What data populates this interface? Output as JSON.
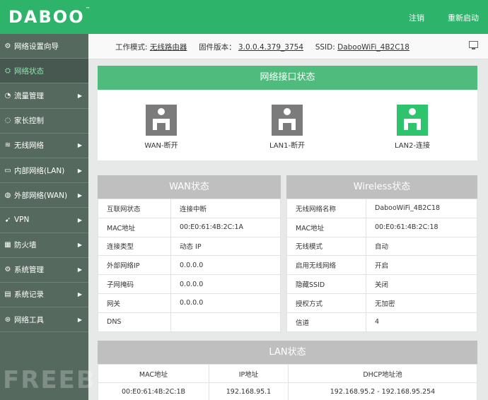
{
  "header": {
    "logo": "DABOO",
    "logo_tm": "™",
    "logout": "注销",
    "reboot": "重新启动"
  },
  "sidebar": {
    "items": [
      {
        "label": "网络设置向导",
        "icon": "gear-icon",
        "has_arrow": false
      },
      {
        "label": "网络状态",
        "icon": "network-status-icon",
        "has_arrow": false,
        "active": true
      },
      {
        "label": "流量管理",
        "icon": "traffic-icon",
        "has_arrow": true
      },
      {
        "label": "家长控制",
        "icon": "bell-icon",
        "has_arrow": false
      },
      {
        "label": "无线网络",
        "icon": "wifi-icon",
        "has_arrow": true
      },
      {
        "label": "内部网络(LAN)",
        "icon": "lan-icon",
        "has_arrow": true
      },
      {
        "label": "外部网络(WAN)",
        "icon": "globe-icon",
        "has_arrow": true
      },
      {
        "label": "VPN",
        "icon": "vpn-icon",
        "has_arrow": true
      },
      {
        "label": "防火墙",
        "icon": "firewall-icon",
        "has_arrow": true
      },
      {
        "label": "系统管理",
        "icon": "system-icon",
        "has_arrow": true
      },
      {
        "label": "系统记录",
        "icon": "log-icon",
        "has_arrow": true
      },
      {
        "label": "网络工具",
        "icon": "tools-icon",
        "has_arrow": true
      }
    ]
  },
  "topbar": {
    "mode_label": "工作模式:",
    "mode_value": "无线路由器",
    "firmware_label": "固件版本：",
    "firmware_value": "3.0.0.4.379_3754",
    "ssid_label": "SSID:",
    "ssid_value": "DabooWiFi_4B2C18"
  },
  "interfaces": {
    "title": "网络接口状态",
    "ports": [
      {
        "label": "WAN-断开",
        "connected": false
      },
      {
        "label": "LAN1-断开",
        "connected": false
      },
      {
        "label": "LAN2-连接",
        "connected": true
      }
    ],
    "colors": {
      "connected": "#2ec46e",
      "disconnected": "#7b7b7b"
    }
  },
  "wan": {
    "title": "WAN状态",
    "rows": [
      {
        "k": "互联网状态",
        "v": "连接中断"
      },
      {
        "k": "MAC地址",
        "v": "00:E0:61:4B:2C:1A"
      },
      {
        "k": "连接类型",
        "v": "动态 IP"
      },
      {
        "k": "外部网络IP",
        "v": "0.0.0.0"
      },
      {
        "k": "子网掩码",
        "v": "0.0.0.0"
      },
      {
        "k": "网关",
        "v": "0.0.0.0"
      },
      {
        "k": "DNS",
        "v": ""
      }
    ]
  },
  "wireless": {
    "title": "Wireless状态",
    "rows": [
      {
        "k": "无线网络名称",
        "v": "DabooWiFi_4B2C18"
      },
      {
        "k": "MAC地址",
        "v": "00:E0:61:4B:2C:18"
      },
      {
        "k": "无线模式",
        "v": "自动"
      },
      {
        "k": "启用无线网络",
        "v": "开启"
      },
      {
        "k": "隐藏SSID",
        "v": "关闭"
      },
      {
        "k": "授权方式",
        "v": "无加密"
      },
      {
        "k": "信道",
        "v": "4"
      }
    ]
  },
  "lan": {
    "title": "LAN状态",
    "headers": [
      "MAC地址",
      "IP地址",
      "DHCP地址池"
    ],
    "row": [
      "00:E0:61:4B:2C:1B",
      "192.168.95.1",
      "192.168.95.2 - 192.168.95.254"
    ]
  },
  "watermark": "FREEBUF",
  "colors": {
    "brand_green": "#2eb36b",
    "panel_green": "#4fbc7e",
    "sidebar": "#55695f"
  }
}
